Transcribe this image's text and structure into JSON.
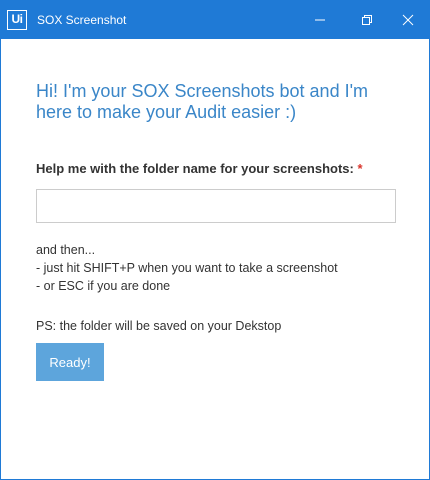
{
  "window": {
    "app_logo_text": "Ui",
    "title": "SOX Screenshot",
    "controls": {
      "minimize": "minimize-icon",
      "maximize": "restore-icon",
      "close": "close-icon"
    },
    "accent_color": "#1f7ad6"
  },
  "main": {
    "greeting": "Hi! I'm your SOX Screenshots bot and I'm here to make your Audit easier :)",
    "folder_label": "Help me with the folder name for your screenshots:",
    "required_marker": "*",
    "folder_input": {
      "value": "",
      "placeholder": ""
    },
    "instructions": [
      "and then...",
      "- just hit SHIFT+P when you want to take a screenshot",
      "- or ESC if you are done"
    ],
    "ps_note": "PS: the folder will be saved on your Dekstop",
    "ready_button_label": "Ready!"
  }
}
